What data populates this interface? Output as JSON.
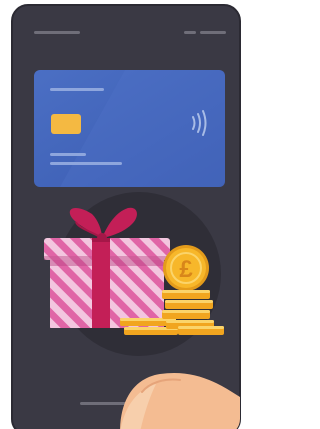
{
  "phone": {
    "status_bar": {
      "left_indicator": "line",
      "right_indicator": "dashes"
    },
    "screen": {
      "card": {
        "icon": "contactless-icon",
        "has_chip": true
      },
      "gift": {
        "icon": "gift-icon"
      },
      "coin": {
        "symbol": "£",
        "icon": "pound-coin-icon"
      },
      "coin_stack": {
        "icon": "coin-stack-icon"
      }
    },
    "home_indicator": "bar",
    "finger": {
      "icon": "finger-icon"
    }
  },
  "colors": {
    "device": "#3a3944",
    "card": "#3f62ba",
    "gift_pink": "#d94a92",
    "ribbon": "#c31f57",
    "coin": "#f7b72a",
    "finger": "#f4bc92"
  }
}
